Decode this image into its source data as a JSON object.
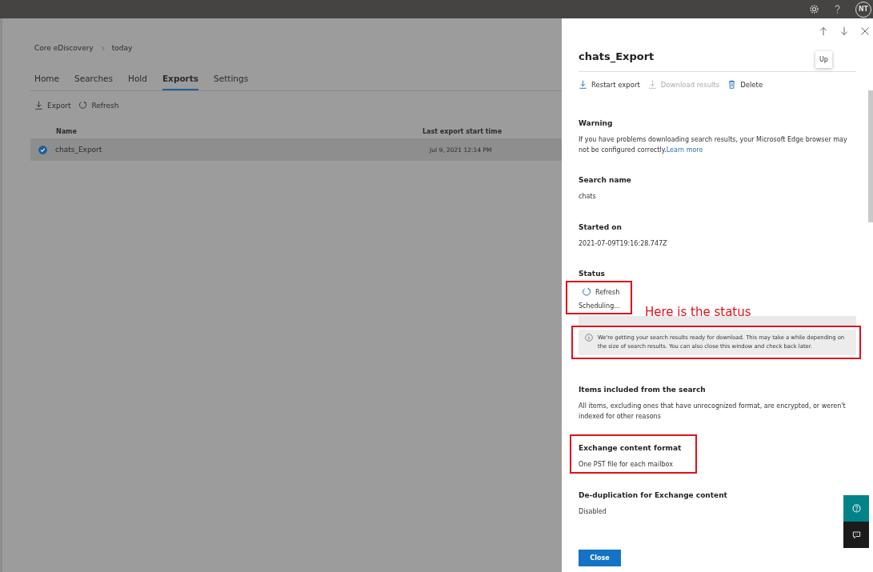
{
  "top_bar": {
    "avatar_initials": "NT"
  },
  "breadcrumb": [
    "Core eDiscovery",
    "today"
  ],
  "tabs": [
    {
      "label": "Home",
      "selected": false
    },
    {
      "label": "Searches",
      "selected": false
    },
    {
      "label": "Hold",
      "selected": false
    },
    {
      "label": "Exports",
      "selected": true
    },
    {
      "label": "Settings",
      "selected": false
    }
  ],
  "toolbar": [
    {
      "kind": "download",
      "label": "Export"
    },
    {
      "kind": "refresh",
      "label": "Refresh"
    }
  ],
  "table": {
    "columns": [
      "Name",
      "Last export start time"
    ],
    "rows": [
      {
        "name": "chats_Export",
        "time": "Jul 9, 2021 12:14 PM",
        "selected": true
      }
    ]
  },
  "panel": {
    "title": "chats_Export",
    "tooltip": "Up",
    "actions": [
      {
        "kind": "download",
        "label": "Restart export",
        "disabled": false
      },
      {
        "kind": "download",
        "label": "Download results",
        "disabled": true
      },
      {
        "kind": "delete",
        "label": "Delete",
        "disabled": false
      }
    ],
    "sections": [
      {
        "kind": "warning",
        "heading": "Warning",
        "body": "If you have problems downloading search results, your Microsoft Edge browser may not be configured correctly.",
        "link": "Learn more",
        "highlighted": false
      },
      {
        "kind": "text",
        "heading": "Search name",
        "body": "chats",
        "highlighted": false
      },
      {
        "kind": "text",
        "heading": "Started on",
        "body": "2021-07-09T19:16:28.747Z",
        "highlighted": false
      },
      {
        "kind": "status",
        "heading": "Status",
        "refresh": "Refresh",
        "body": "Scheduling...",
        "info": "We're getting your search results ready for download. This may take a while depending on the size of search results. You can also close this window and check back later.",
        "highlighted": true
      },
      {
        "kind": "text",
        "heading": "Items included from the search",
        "body": "All items, excluding ones that have unrecognized format, are encrypted, or weren't indexed for other reasons",
        "highlighted": false
      },
      {
        "kind": "text",
        "heading": "Exchange content format",
        "body": "One PST file for each mailbox",
        "highlighted": true
      },
      {
        "kind": "text",
        "heading": "De-duplication for Exchange content",
        "body": "Disabled",
        "highlighted": false
      }
    ],
    "close_button": "Close"
  },
  "annotation": {
    "text": "Here is the status"
  }
}
